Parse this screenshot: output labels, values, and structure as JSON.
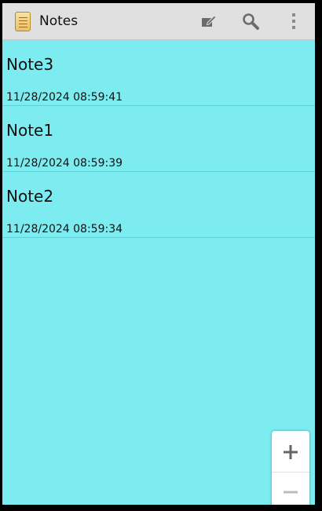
{
  "app": {
    "title": "Notes",
    "icon": "notepad-icon"
  },
  "toolbar": {
    "actions": [
      {
        "name": "new-note",
        "icon": "edit-note-icon"
      },
      {
        "name": "search",
        "icon": "search-icon"
      },
      {
        "name": "overflow-menu",
        "icon": "more-vert-icon"
      }
    ]
  },
  "notes": [
    {
      "title": "Note3",
      "date": "11/28/2024 08:59:41"
    },
    {
      "title": "Note1",
      "date": "11/28/2024 08:59:39"
    },
    {
      "title": "Note2",
      "date": "11/28/2024 08:59:34"
    }
  ],
  "zoom_controls": {
    "zoom_in_icon": "plus-icon",
    "zoom_out_icon": "minus-icon"
  },
  "colors": {
    "background": "#7cecf1",
    "action_bar": "#e0e0e0",
    "divider": "#5fd0d6"
  }
}
